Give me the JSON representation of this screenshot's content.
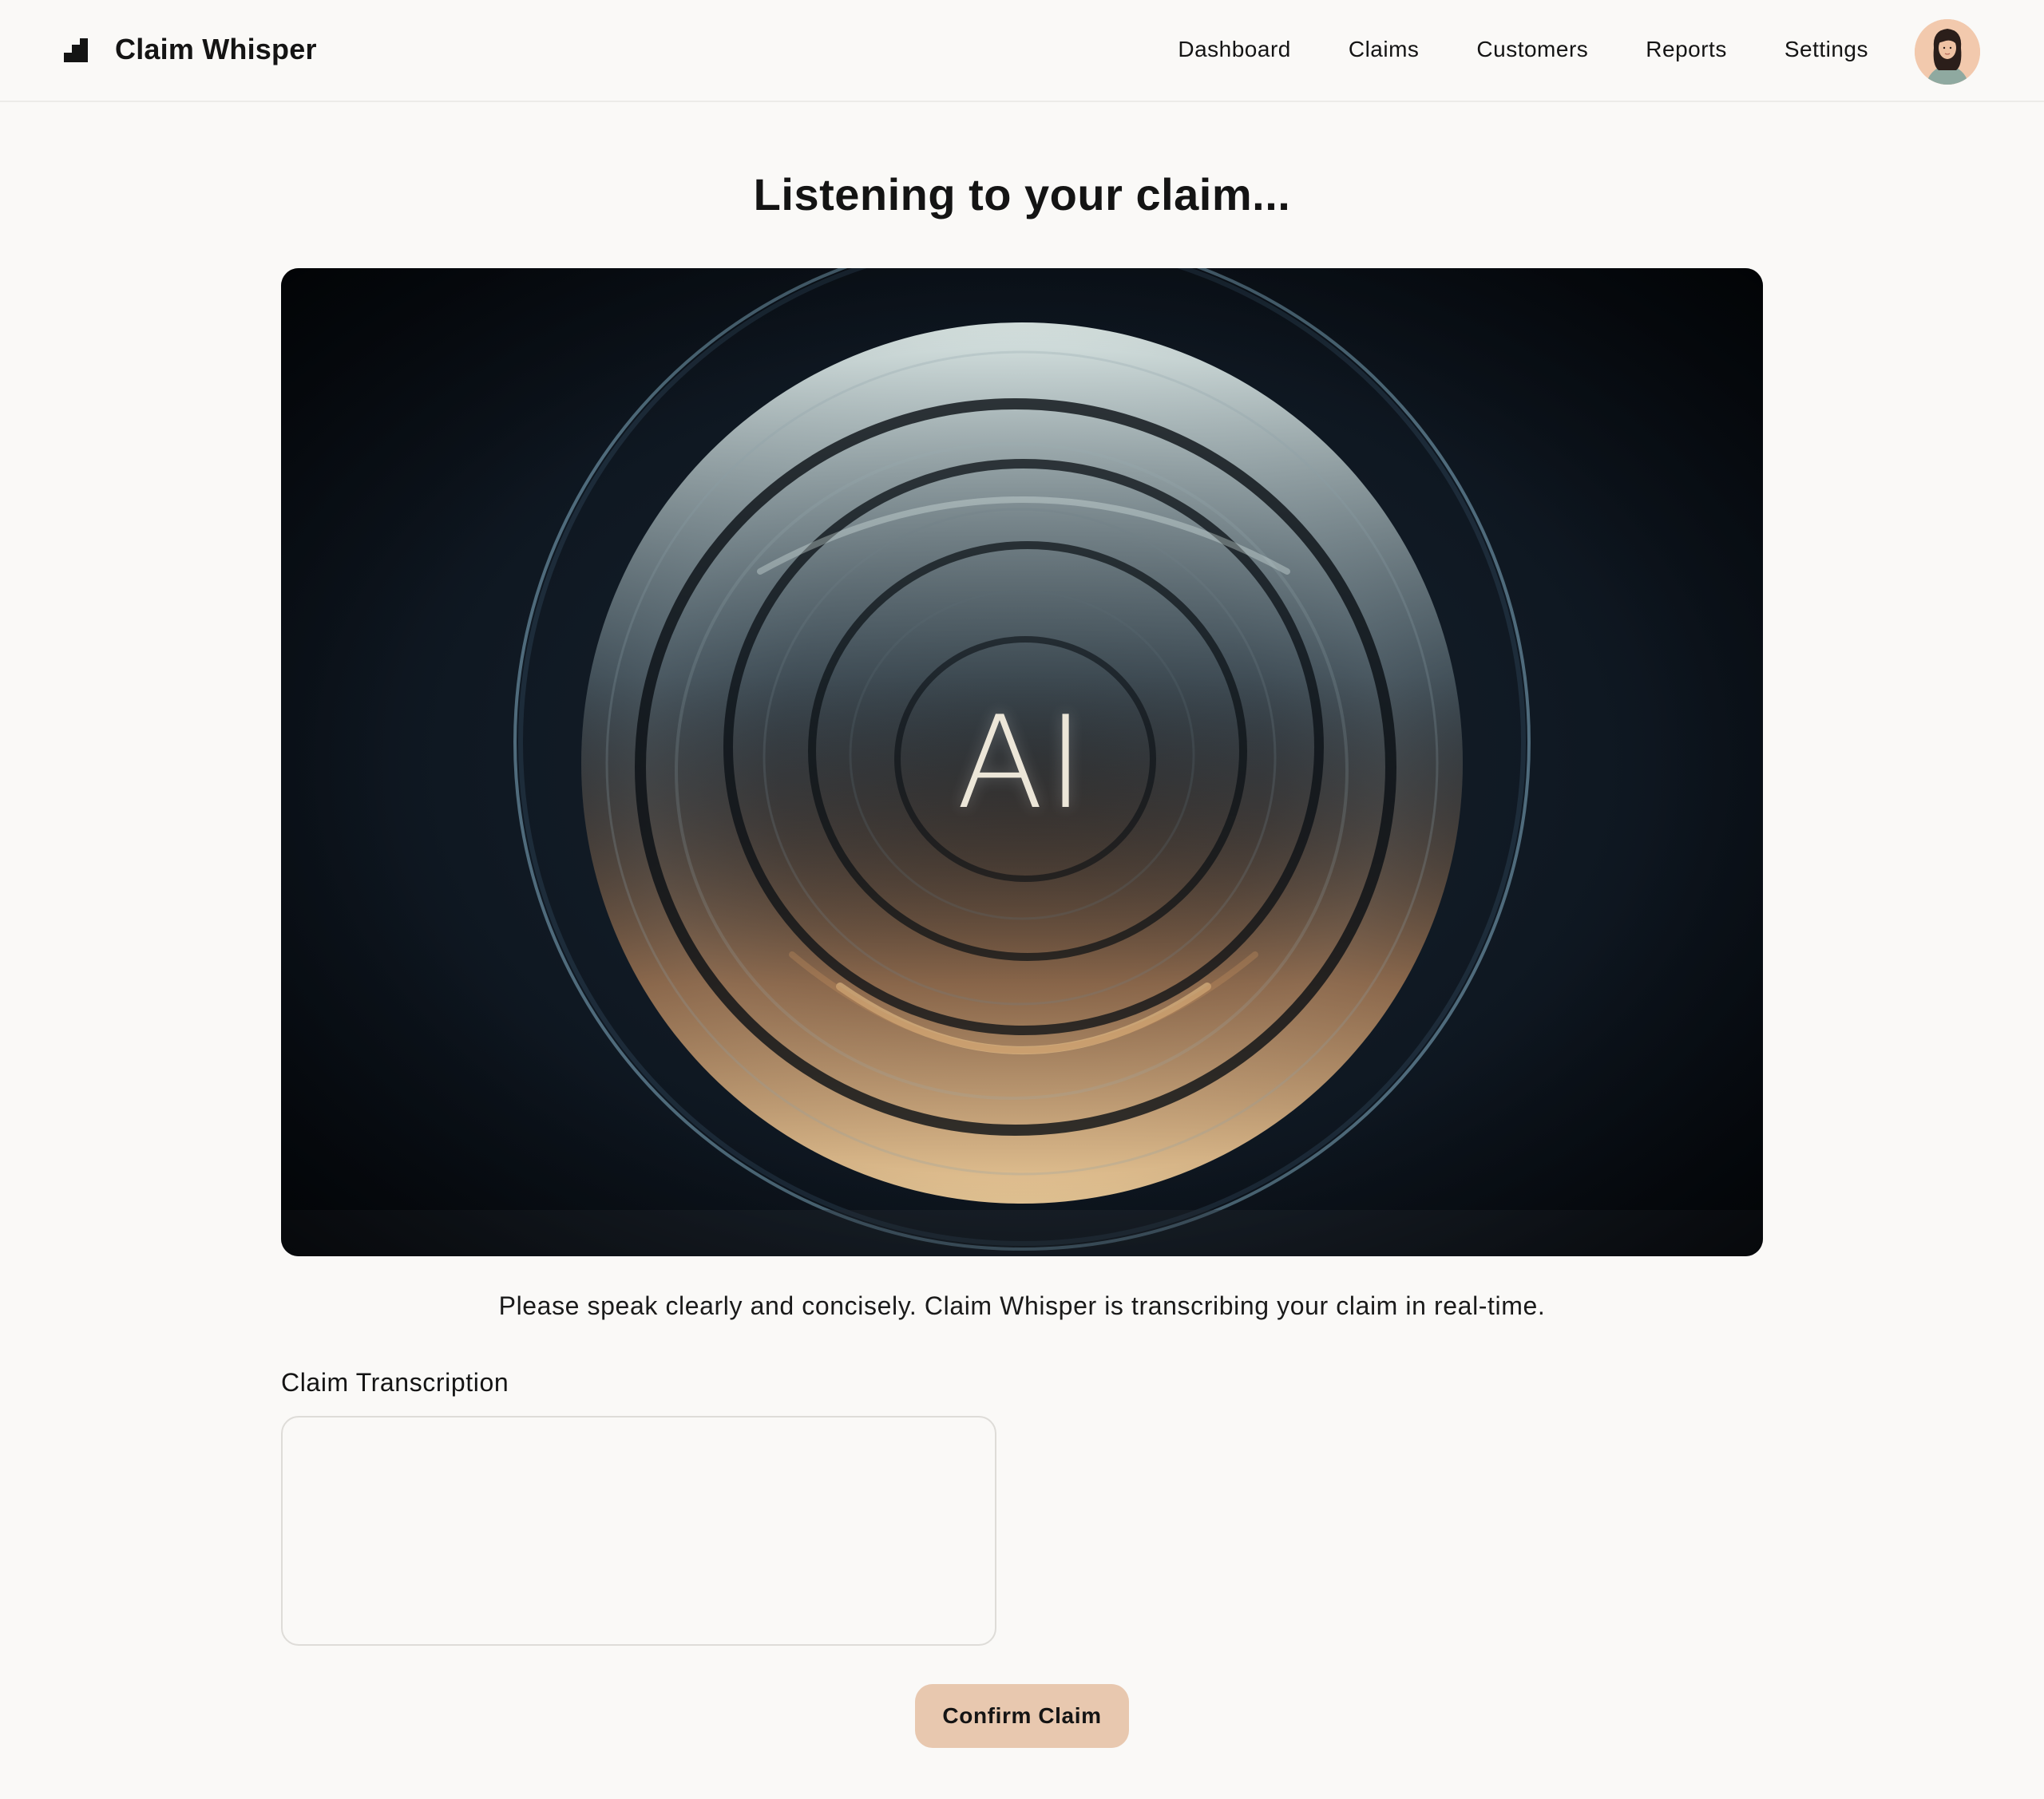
{
  "app": {
    "title": "Claim Whisper",
    "logo_icon": "stairs-logo-icon"
  },
  "nav": {
    "items": [
      {
        "label": "Dashboard"
      },
      {
        "label": "Claims"
      },
      {
        "label": "Customers"
      },
      {
        "label": "Reports"
      },
      {
        "label": "Settings"
      }
    ],
    "avatar_icon": "user-avatar"
  },
  "main": {
    "title": "Listening to your claim...",
    "hero_text": "AI",
    "instructions": "Please speak clearly and concisely. Claim Whisper is transcribing your claim in real-time.",
    "transcription_label": "Claim Transcription",
    "transcription_value": "",
    "confirm_label": "Confirm Claim"
  },
  "colors": {
    "background": "#faf9f7",
    "accent_button": "#e8c8af",
    "text": "#141414",
    "hero_dark": "#0f1822"
  }
}
